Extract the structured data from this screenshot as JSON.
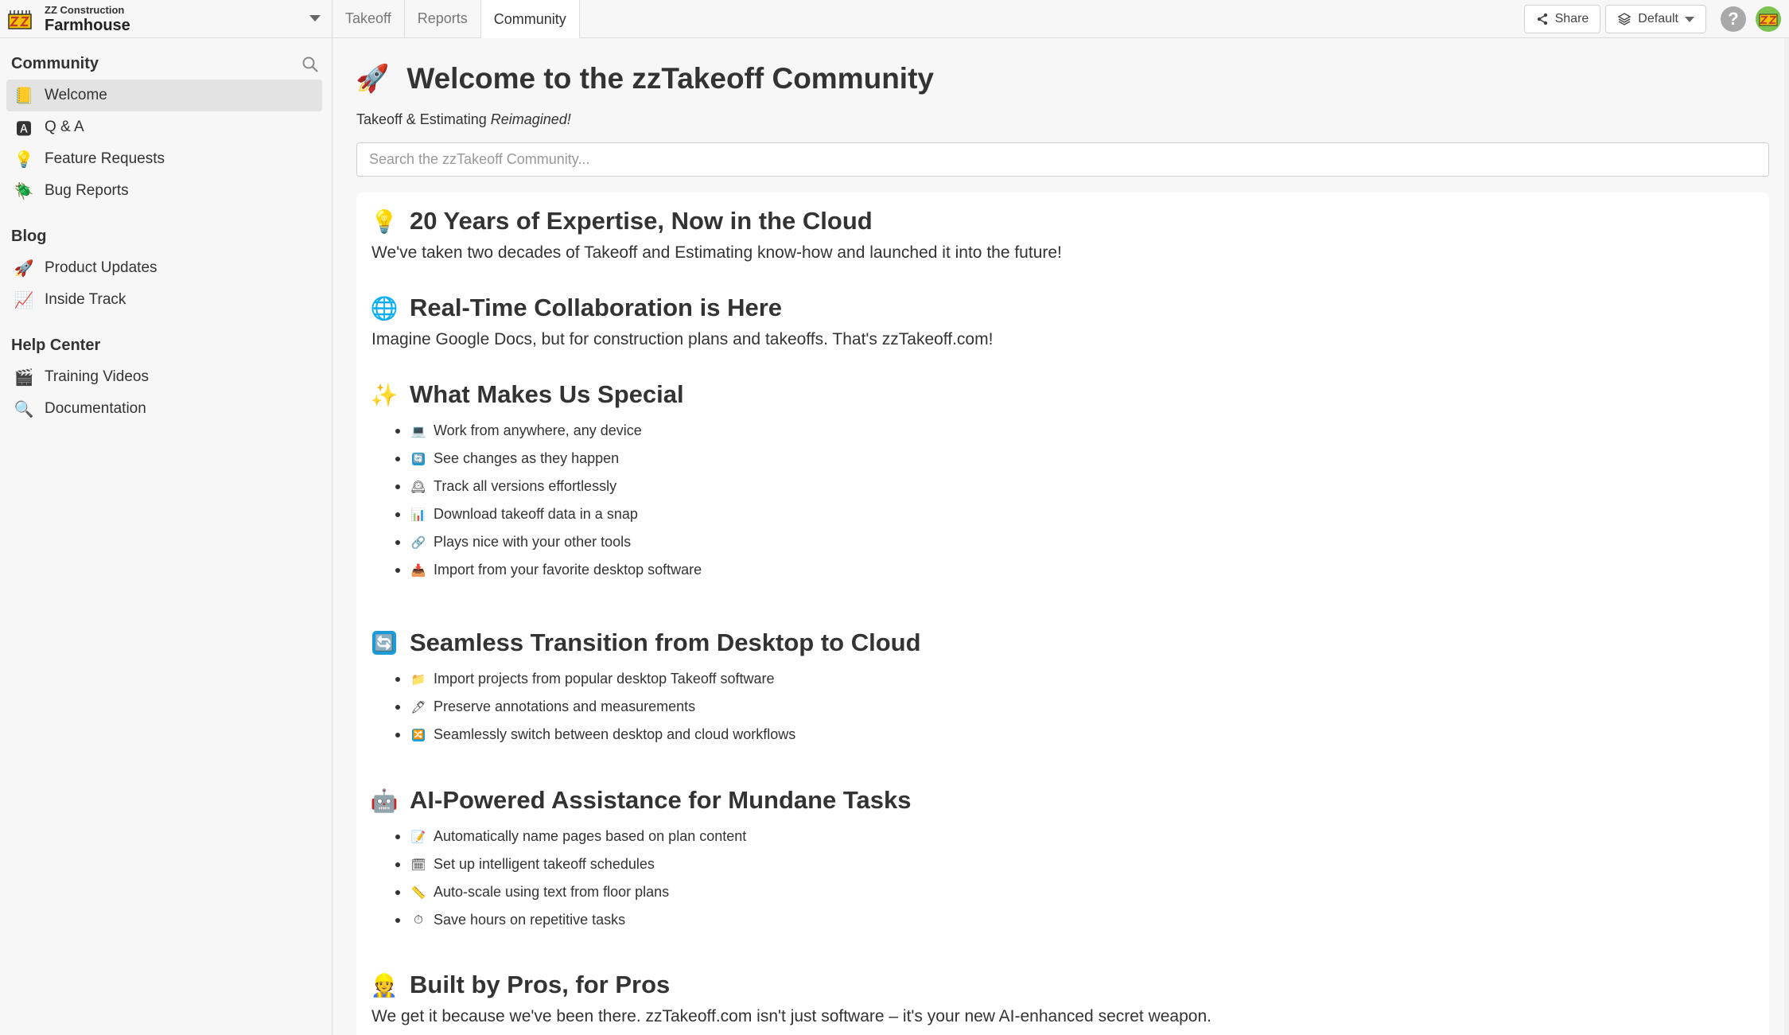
{
  "project": {
    "company": "ZZ Construction",
    "name": "Farmhouse"
  },
  "tabs": [
    {
      "label": "Takeoff"
    },
    {
      "label": "Reports"
    },
    {
      "label": "Community"
    }
  ],
  "toolbar": {
    "share_label": "Share",
    "layout_label": "Default",
    "help_label": "?"
  },
  "sidebar": {
    "sections": [
      {
        "title": "Community",
        "items": [
          {
            "label": "Welcome",
            "icon": "📒"
          },
          {
            "label": "Q & A",
            "icon": "🅰"
          },
          {
            "label": "Feature Requests",
            "icon": "💡"
          },
          {
            "label": "Bug Reports",
            "icon": "🪲"
          }
        ]
      },
      {
        "title": "Blog",
        "items": [
          {
            "label": "Product Updates",
            "icon": "🚀"
          },
          {
            "label": "Inside Track",
            "icon": "📈"
          }
        ]
      },
      {
        "title": "Help Center",
        "items": [
          {
            "label": "Training Videos",
            "icon": "🎬"
          },
          {
            "label": "Documentation",
            "icon": "🔍"
          }
        ]
      }
    ]
  },
  "main": {
    "title_icon": "🚀",
    "title": "Welcome to the zzTakeoff Community",
    "tagline_prefix": "Takeoff & Estimating ",
    "tagline_emphasis": "Reimagined!",
    "search_placeholder": "Search the zzTakeoff Community...",
    "sections": [
      {
        "icon": "💡",
        "title": "20 Years of Expertise, Now in the Cloud",
        "text": "We've taken two decades of Takeoff and Estimating know-how and launched it into the future!"
      },
      {
        "icon": "🌐",
        "title": "Real-Time Collaboration is Here",
        "text": "Imagine Google Docs, but for construction plans and takeoffs. That's zzTakeoff.com!"
      },
      {
        "icon": "✨",
        "title": "What Makes Us Special",
        "items": [
          {
            "icon": "💻",
            "text": "Work from anywhere, any device"
          },
          {
            "icon": "🔄",
            "text": "See changes as they happen"
          },
          {
            "icon": "🕰",
            "text": "Track all versions effortlessly"
          },
          {
            "icon": "📊",
            "text": "Download takeoff data in a snap"
          },
          {
            "icon": "🔗",
            "text": "Plays nice with your other tools"
          },
          {
            "icon": "📥",
            "text": "Import from your favorite desktop software"
          }
        ]
      },
      {
        "icon": "🔄",
        "title": "Seamless Transition from Desktop to Cloud",
        "items": [
          {
            "icon": "📁",
            "text": "Import projects from popular desktop Takeoff software"
          },
          {
            "icon": "🖊",
            "text": "Preserve annotations and measurements"
          },
          {
            "icon": "🔀",
            "text": "Seamlessly switch between desktop and cloud workflows"
          }
        ]
      },
      {
        "icon": "🤖",
        "title": "AI-Powered Assistance for Mundane Tasks",
        "items": [
          {
            "icon": "📝",
            "text": "Automatically name pages based on plan content"
          },
          {
            "icon": "🗓",
            "text": "Set up intelligent takeoff schedules"
          },
          {
            "icon": "📏",
            "text": "Auto-scale using text from floor plans"
          },
          {
            "icon": "⏱",
            "text": "Save hours on repetitive tasks"
          }
        ]
      },
      {
        "icon": "👷",
        "title": "Built by Pros, for Pros",
        "text": "We get it because we've been there. zzTakeoff.com isn't just software – it's your new AI-enhanced secret weapon."
      }
    ]
  },
  "colors": {
    "accent_blue": "#1b9bd7",
    "active_nav": "#e3e3e3",
    "border": "#dcdcdc"
  }
}
